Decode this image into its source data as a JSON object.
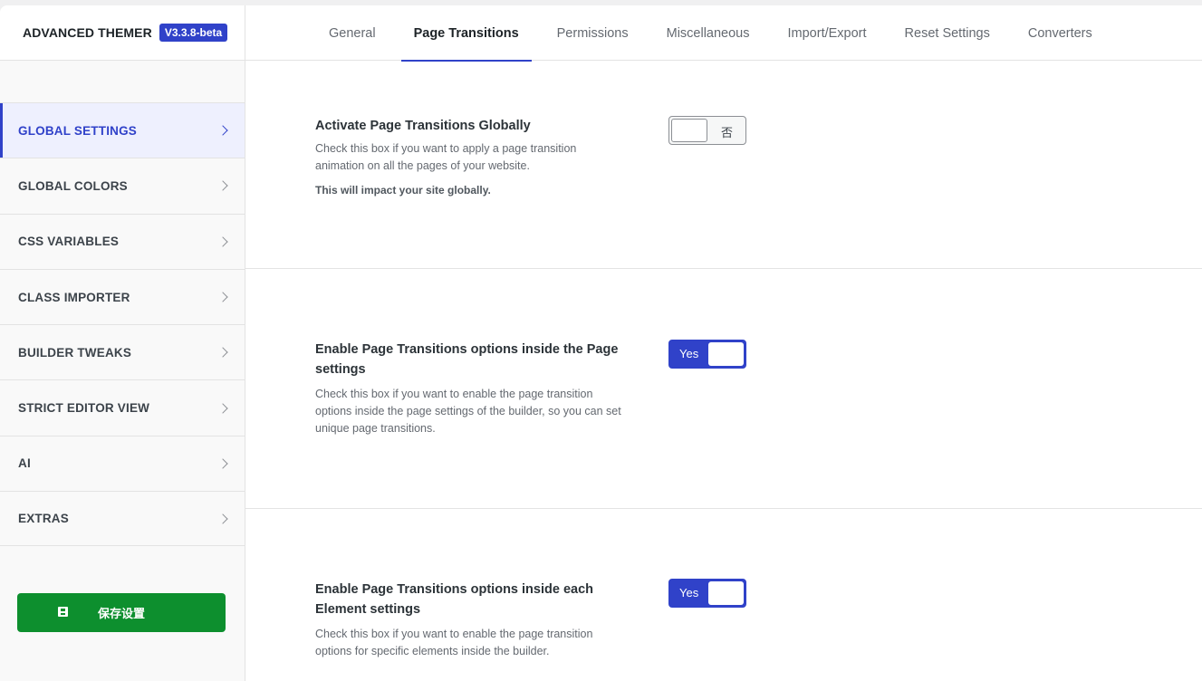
{
  "brand": {
    "name": "ADVANCED THEMER",
    "version": "V3.3.8-beta"
  },
  "tabs": [
    {
      "label": "General",
      "active": false
    },
    {
      "label": "Page Transitions",
      "active": true
    },
    {
      "label": "Permissions",
      "active": false
    },
    {
      "label": "Miscellaneous",
      "active": false
    },
    {
      "label": "Import/Export",
      "active": false
    },
    {
      "label": "Reset Settings",
      "active": false
    },
    {
      "label": "Converters",
      "active": false
    }
  ],
  "sidebar": {
    "items": [
      {
        "label": "GLOBAL SETTINGS",
        "active": true
      },
      {
        "label": "GLOBAL COLORS"
      },
      {
        "label": "CSS VARIABLES"
      },
      {
        "label": "CLASS IMPORTER"
      },
      {
        "label": "BUILDER TWEAKS"
      },
      {
        "label": "STRICT EDITOR VIEW"
      },
      {
        "label": "AI"
      },
      {
        "label": "EXTRAS"
      }
    ],
    "save_label": "保存设置"
  },
  "settings": [
    {
      "title": "Activate Page Transitions Globally",
      "description_lines": [
        "Check this box if you want to apply a page transition",
        "animation on all the pages of your website."
      ],
      "warning": "This will impact your site globally.",
      "toggle": {
        "state": "off",
        "label": "否"
      }
    },
    {
      "title_lines": [
        "Enable Page Transitions options inside the Page",
        "settings"
      ],
      "description_lines": [
        "Check this box if you want to enable the page transition",
        "options inside the page settings of the builder, so you can set",
        "unique page transitions."
      ],
      "toggle": {
        "state": "on",
        "label": "Yes"
      }
    },
    {
      "title_lines": [
        "Enable Page Transitions options inside each",
        "Element settings"
      ],
      "description_lines": [
        "Check this box if you want to enable the page transition",
        "options for specific elements inside the builder."
      ],
      "toggle": {
        "state": "on",
        "label": "Yes"
      }
    }
  ],
  "colors": {
    "accent": "#3042c9",
    "save": "#0d8f2e"
  }
}
